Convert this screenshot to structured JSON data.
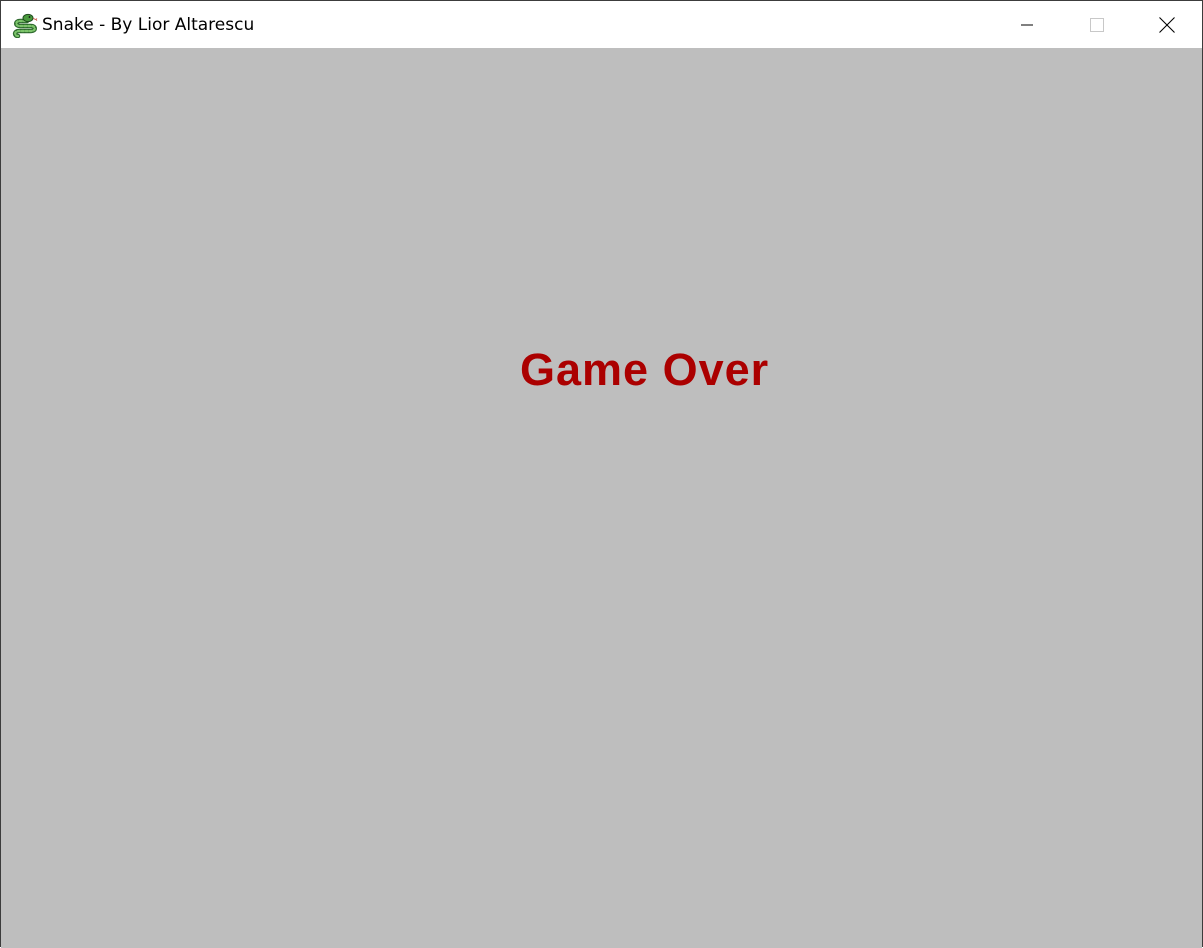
{
  "window": {
    "title": "Snake - By Lior Altarescu",
    "app_icon": "snake-icon",
    "controls": {
      "minimize_icon": "minimize-icon",
      "maximize_icon": "maximize-icon",
      "close_icon": "close-icon"
    }
  },
  "game": {
    "message": "Game Over",
    "background_color": "#bebebe",
    "message_color": "#ab0000"
  }
}
